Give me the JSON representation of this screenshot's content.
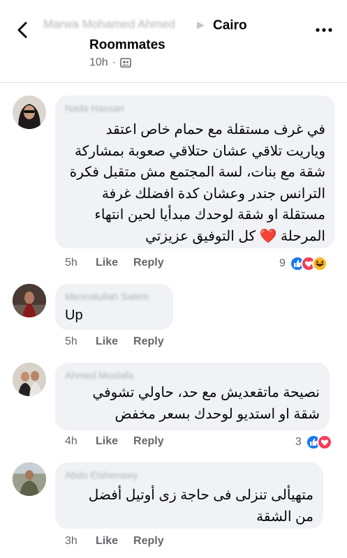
{
  "header": {
    "blurred_author": "Marwa Mohamed Ahmed",
    "group_title_line1": "Cairo",
    "group_title_line2": "Roommates",
    "time": "10h",
    "back_icon": "chevron-left-icon",
    "more_icon": "more-horizontal-icon",
    "privacy_icon": "group-privacy-icon"
  },
  "comments": [
    {
      "author": "Nada Hassan",
      "text": "في غرف مستقلة مع حمام خاص اعتقد وياريت تلاقي عشان حتلاقي صعوبة بمشاركة شقة مع بنات، لسة المجتمع مش متقبل فكرة الترانس جندر وعشان كدة افضلك غرفة مستقلة او شقة لوحدك مبدأيا لحين انتهاء المرحلة ❤️ كل التوفيق عزيزتي",
      "time": "5h",
      "like": "Like",
      "reply": "Reply",
      "reaction_count": "9"
    },
    {
      "author": "Mennatullah Salem",
      "text": "Up",
      "time": "5h",
      "like": "Like",
      "reply": "Reply",
      "reaction_count": ""
    },
    {
      "author": "Ahmed Mostafa",
      "text": "نصيحة ماتقعديش مع حد، حاولي تشوفي شقة او استديو لوحدك بسعر مخفض",
      "time": "4h",
      "like": "Like",
      "reply": "Reply",
      "reaction_count": "3"
    },
    {
      "author": "Abdo Elshenawy",
      "text": "متهيألى تنزلى فى حاجة زى أوتيل أفضل من الشقة",
      "time": "3h",
      "like": "Like",
      "reply": "Reply",
      "reaction_count": ""
    }
  ],
  "colors": {
    "like_blue": "#1877f2",
    "love_red": "#f33e58",
    "haha_yellow": "#f7b928",
    "bubble_gray": "#f0f2f5",
    "meta_gray": "#65676b"
  }
}
